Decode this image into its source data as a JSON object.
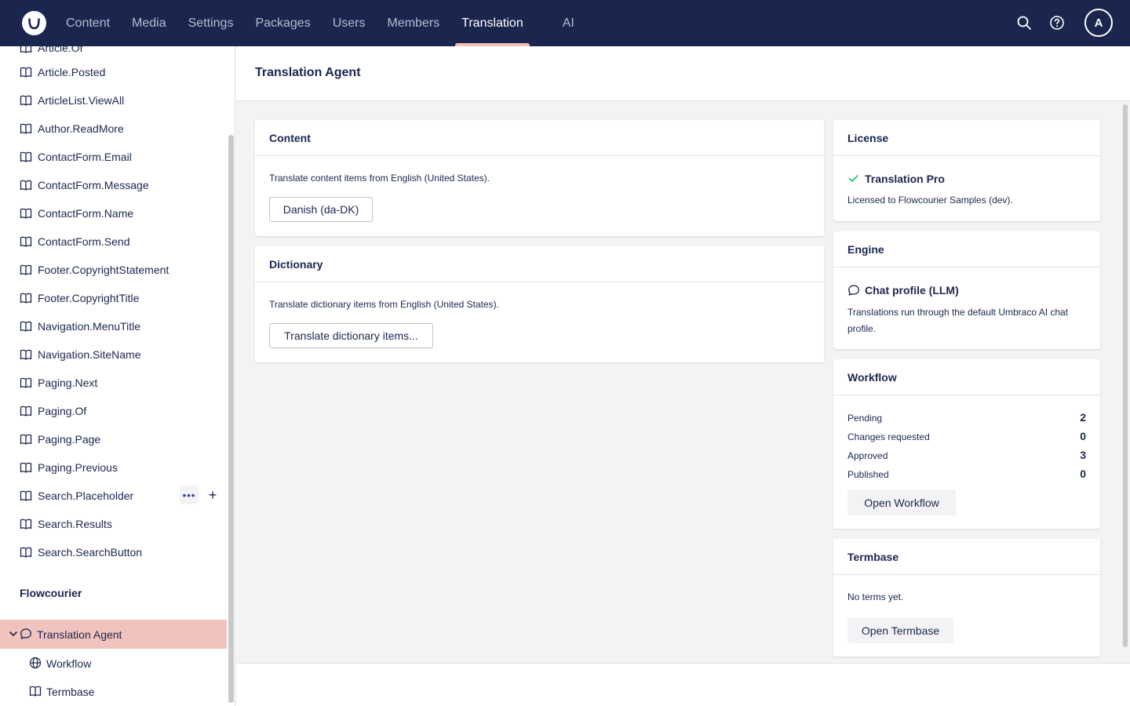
{
  "topnav": {
    "items": [
      "Content",
      "Media",
      "Settings",
      "Packages",
      "Users",
      "Members",
      "Translation",
      "AI"
    ],
    "active": "Translation",
    "avatar_initial": "A"
  },
  "sidebar": {
    "partial_item": "Article.Of",
    "items": [
      "Article.Posted",
      "ArticleList.ViewAll",
      "Author.ReadMore",
      "ContactForm.Email",
      "ContactForm.Message",
      "ContactForm.Name",
      "ContactForm.Send",
      "Footer.CopyrightStatement",
      "Footer.CopyrightTitle",
      "Navigation.MenuTitle",
      "Navigation.SiteName",
      "Paging.Next",
      "Paging.Of",
      "Paging.Page",
      "Paging.Previous",
      "Search.Placeholder",
      "Search.Results",
      "Search.SearchButton"
    ],
    "section_title": "Flowcourier",
    "active_item": "Translation Agent",
    "sub_items": [
      "Workflow",
      "Termbase"
    ]
  },
  "main": {
    "title": "Translation Agent",
    "content_card": {
      "title": "Content",
      "description": "Translate content items from English (United States).",
      "button": "Danish (da-DK)"
    },
    "dictionary_card": {
      "title": "Dictionary",
      "description": "Translate dictionary items from English (United States).",
      "button": "Translate dictionary items..."
    },
    "license_card": {
      "title": "License",
      "plan": "Translation Pro",
      "licensed_to": "Licensed to Flowcourier Samples (dev)."
    },
    "engine_card": {
      "title": "Engine",
      "engine_name": "Chat profile (LLM)",
      "description": "Translations run through the default Umbraco AI chat profile."
    },
    "workflow_card": {
      "title": "Workflow",
      "rows": [
        {
          "label": "Pending",
          "value": "2"
        },
        {
          "label": "Changes requested",
          "value": "0"
        },
        {
          "label": "Approved",
          "value": "3"
        },
        {
          "label": "Published",
          "value": "0"
        }
      ],
      "button": "Open Workflow"
    },
    "termbase_card": {
      "title": "Termbase",
      "description": "No terms yet.",
      "button": "Open Termbase"
    }
  },
  "colors": {
    "header_bg": "#1b264f",
    "active_highlight": "#f1c3be",
    "check_green": "#2bc37c"
  }
}
